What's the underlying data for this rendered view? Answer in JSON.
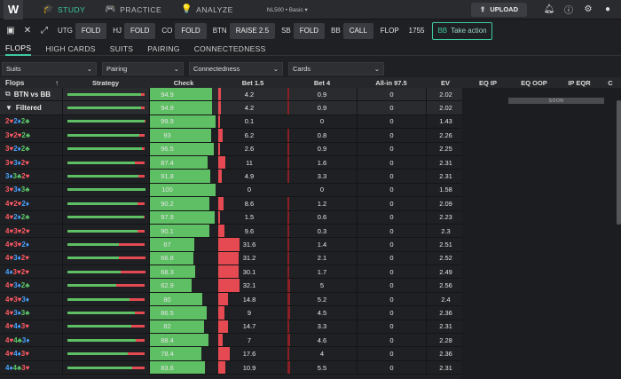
{
  "nav": {
    "logo": "W",
    "tabs": [
      {
        "label": "STUDY",
        "icon": "graduation-cap-icon"
      },
      {
        "label": "PRACTICE",
        "icon": "gamepad-icon"
      },
      {
        "label": "ANALYZE",
        "icon": "lightbulb-icon"
      }
    ],
    "version": "NL500 • Basic ▾",
    "upload": "UPLOAD"
  },
  "actions": [
    {
      "pos": "UTG",
      "act": "FOLD"
    },
    {
      "pos": "HJ",
      "act": "FOLD"
    },
    {
      "pos": "CO",
      "act": "FOLD"
    },
    {
      "pos": "BTN",
      "act": "RAISE 2.5"
    },
    {
      "pos": "SB",
      "act": "FOLD"
    },
    {
      "pos": "BB",
      "act": "CALL"
    }
  ],
  "flop": {
    "label": "FLOP",
    "count": "1755"
  },
  "take": {
    "pos": "BB",
    "label": "Take action"
  },
  "subtabs": [
    "FLOPS",
    "HIGH CARDS",
    "SUITS",
    "PAIRING",
    "CONNECTEDNESS"
  ],
  "filters": [
    "Suits",
    "Pairing",
    "Connectedness",
    "Cards"
  ],
  "headers": {
    "flops": "Flops",
    "sort": "↑",
    "strategy": "Strategy",
    "check": "Check",
    "bet15": "Bet 1.5",
    "bet4": "Bet 4",
    "allin": "All-in 97.5",
    "ev": "EV",
    "eqip": "EQ IP",
    "eqoop": "EQ OOP",
    "ipeqr": "IP EQR",
    "c": "C"
  },
  "soon": "SOON",
  "summary": [
    {
      "icon": "copy-icon",
      "label": "BTN vs BB",
      "check": "94.9",
      "b15": "4.2",
      "b4": "0.9",
      "allin": "0",
      "ev": "2.02"
    },
    {
      "icon": "filter-icon",
      "label": "Filtered",
      "check": "94.9",
      "b15": "4.2",
      "b4": "0.9",
      "allin": "0",
      "ev": "2.02"
    }
  ],
  "rows": [
    {
      "cards": [
        [
          "2",
          "h"
        ],
        [
          "2",
          "d"
        ],
        [
          "2",
          "c"
        ]
      ],
      "check": "99.9",
      "b15": "0.1",
      "b4": "0",
      "allin": "0",
      "ev": "1.43"
    },
    {
      "cards": [
        [
          "3",
          "h"
        ],
        [
          "2",
          "h"
        ],
        [
          "2",
          "c"
        ]
      ],
      "check": "93",
      "b15": "6.2",
      "b4": "0.8",
      "allin": "0",
      "ev": "2.26"
    },
    {
      "cards": [
        [
          "3",
          "h"
        ],
        [
          "2",
          "d"
        ],
        [
          "2",
          "c"
        ]
      ],
      "check": "96.5",
      "b15": "2.6",
      "b4": "0.9",
      "allin": "0",
      "ev": "2.25"
    },
    {
      "cards": [
        [
          "3",
          "h"
        ],
        [
          "3",
          "d"
        ],
        [
          "2",
          "h"
        ]
      ],
      "check": "87.4",
      "b15": "11",
      "b4": "1.6",
      "allin": "0",
      "ev": "2.31"
    },
    {
      "cards": [
        [
          "3",
          "d"
        ],
        [
          "3",
          "c"
        ],
        [
          "2",
          "h"
        ]
      ],
      "check": "91.8",
      "b15": "4.9",
      "b4": "3.3",
      "allin": "0",
      "ev": "2.31"
    },
    {
      "cards": [
        [
          "3",
          "h"
        ],
        [
          "3",
          "d"
        ],
        [
          "3",
          "c"
        ]
      ],
      "check": "100",
      "b15": "0",
      "b4": "0",
      "allin": "0",
      "ev": "1.58"
    },
    {
      "cards": [
        [
          "4",
          "h"
        ],
        [
          "2",
          "h"
        ],
        [
          "2",
          "d"
        ]
      ],
      "check": "90.2",
      "b15": "8.6",
      "b4": "1.2",
      "allin": "0",
      "ev": "2.09"
    },
    {
      "cards": [
        [
          "4",
          "h"
        ],
        [
          "2",
          "d"
        ],
        [
          "2",
          "c"
        ]
      ],
      "check": "97.9",
      "b15": "1.5",
      "b4": "0.6",
      "allin": "0",
      "ev": "2.23"
    },
    {
      "cards": [
        [
          "4",
          "h"
        ],
        [
          "3",
          "h"
        ],
        [
          "2",
          "h"
        ]
      ],
      "check": "90.1",
      "b15": "9.6",
      "b4": "0.3",
      "allin": "0",
      "ev": "2.3"
    },
    {
      "cards": [
        [
          "4",
          "h"
        ],
        [
          "3",
          "h"
        ],
        [
          "2",
          "d"
        ]
      ],
      "check": "67",
      "b15": "31.6",
      "b4": "1.4",
      "allin": "0",
      "ev": "2.51"
    },
    {
      "cards": [
        [
          "4",
          "h"
        ],
        [
          "3",
          "d"
        ],
        [
          "2",
          "h"
        ]
      ],
      "check": "66.8",
      "b15": "31.2",
      "b4": "2.1",
      "allin": "0",
      "ev": "2.52"
    },
    {
      "cards": [
        [
          "4",
          "d"
        ],
        [
          "3",
          "h"
        ],
        [
          "2",
          "h"
        ]
      ],
      "check": "68.3",
      "b15": "30.1",
      "b4": "1.7",
      "allin": "0",
      "ev": "2.49"
    },
    {
      "cards": [
        [
          "4",
          "h"
        ],
        [
          "3",
          "d"
        ],
        [
          "2",
          "c"
        ]
      ],
      "check": "62.9",
      "b15": "32.1",
      "b4": "5",
      "allin": "0",
      "ev": "2.56"
    },
    {
      "cards": [
        [
          "4",
          "h"
        ],
        [
          "3",
          "h"
        ],
        [
          "3",
          "d"
        ]
      ],
      "check": "80",
      "b15": "14.8",
      "b4": "5.2",
      "allin": "0",
      "ev": "2.4"
    },
    {
      "cards": [
        [
          "4",
          "h"
        ],
        [
          "3",
          "d"
        ],
        [
          "3",
          "c"
        ]
      ],
      "check": "86.5",
      "b15": "9",
      "b4": "4.5",
      "allin": "0",
      "ev": "2.36"
    },
    {
      "cards": [
        [
          "4",
          "h"
        ],
        [
          "4",
          "d"
        ],
        [
          "3",
          "h"
        ]
      ],
      "check": "82",
      "b15": "14.7",
      "b4": "3.3",
      "allin": "0",
      "ev": "2.31"
    },
    {
      "cards": [
        [
          "4",
          "h"
        ],
        [
          "4",
          "c"
        ],
        [
          "3",
          "d"
        ]
      ],
      "check": "88.4",
      "b15": "7",
      "b4": "4.6",
      "allin": "0",
      "ev": "2.28"
    },
    {
      "cards": [
        [
          "4",
          "h"
        ],
        [
          "4",
          "d"
        ],
        [
          "3",
          "h"
        ]
      ],
      "check": "78.4",
      "b15": "17.6",
      "b4": "4",
      "allin": "0",
      "ev": "2.36"
    },
    {
      "cards": [
        [
          "4",
          "d"
        ],
        [
          "4",
          "c"
        ],
        [
          "3",
          "h"
        ]
      ],
      "check": "83.6",
      "b15": "10.9",
      "b4": "5.5",
      "allin": "0",
      "ev": "2.31"
    }
  ]
}
